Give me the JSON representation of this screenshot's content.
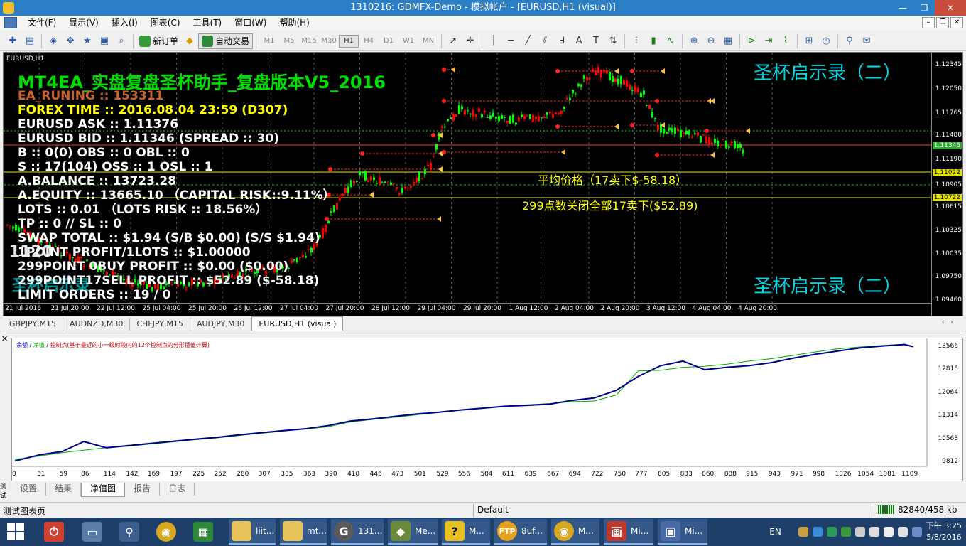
{
  "window": {
    "title": "1310216: GDMFX-Demo - 模拟帐户 - [EURUSD,H1 (visual)]",
    "minimize": "—",
    "restore": "❐",
    "close": "✕"
  },
  "menu": {
    "items": [
      "文件(F)",
      "显示(V)",
      "插入(I)",
      "图表(C)",
      "工具(T)",
      "窗口(W)",
      "帮助(H)"
    ],
    "mdi_buttons": [
      "–",
      "❐",
      "✕"
    ]
  },
  "toolbar": {
    "new_order": "新订单",
    "auto_trading": "自动交易",
    "timeframes": [
      "M1",
      "M5",
      "M15",
      "M30",
      "H1",
      "H4",
      "D1",
      "W1",
      "MN"
    ],
    "active_timeframe": "H1"
  },
  "chart": {
    "symbol_label": "EURUSD,H1",
    "ea_title": "MT4EA_实盘复盘圣杯助手_复盘版本V5_2016",
    "ea_running": "EA_RUNING :: 153311",
    "forex_time": "FOREX TIME :: 2016.08.04 23:59 (D307)",
    "info_lines": [
      "EURUSD ASK :: 1.11376",
      "EURUSD BID :: 1.11346  (SPREAD :: 30)",
      "B :: 0(0)  OBS :: 0  OBL :: 0",
      "S :: 17(104)  OSS :: 1  OSL :: 1",
      "A.BALANCE :: 13723.28",
      "A.EQUITY :: 13665.10 （CAPITAL RISK::9.11%）",
      "LOTS :: 0.01 （LOTS RISK :: 18.56%）",
      "TP :: 0 // SL :: 0",
      "SWAP TOTAL :: $1.94  (S/B $0.00)  (S/S $1.94)",
      "1POINT PROFIT/1LOTS :: $1.00000",
      "299POINT 0BUY PROFIT :: $0.00 ($0.00)",
      "299POINT17SELL PROFIT :: $52.89 ($-58.18)",
      "LIMIT ORDERS :: 19 / 0"
    ],
    "big_number": "1120",
    "ghost_text": "圣杯启示录",
    "watermark_top": "圣杯启示录（二）",
    "watermark_bottom": "圣杯启示录（二）",
    "avg_price": "平均价格（17卖下$-58.18）",
    "close_all": "299点数关闭全部17卖下($52.89)",
    "price_labels": [
      "1.12345",
      "1.12050",
      "1.11765",
      "1.11480",
      "1.11346",
      "1.11190",
      "1.11022",
      "1.10905",
      "1.10722",
      "1.10615",
      "1.10325",
      "1.10035",
      "1.09750",
      "1.09460"
    ],
    "highlight_bid": "1.11346",
    "highlight_level1": "1.11022",
    "highlight_level2": "1.10722",
    "time_labels": [
      "21 Jul 2016",
      "21 Jul 20:00",
      "22 Jul 12:00",
      "25 Jul 04:00",
      "25 Jul 20:00",
      "26 Jul 12:00",
      "27 Jul 04:00",
      "27 Jul 20:00",
      "28 Jul 12:00",
      "29 Jul 04:00",
      "29 Jul 20:00",
      "1 Aug 12:00",
      "2 Aug 04:00",
      "2 Aug 20:00",
      "3 Aug 12:00",
      "4 Aug 04:00",
      "4 Aug 20:00"
    ],
    "colors": {
      "bull": "#00ff00",
      "bear": "#ff0000",
      "grid": "#5a5a5a"
    }
  },
  "chart_tabs": {
    "items": [
      "GBPJPY,M15",
      "AUDNZD,M30",
      "CHFJPY,M15",
      "AUDJPY,M30",
      "EURUSD,H1 (visual)"
    ],
    "active": 4
  },
  "tester": {
    "vertical_label": "测试",
    "legend_balance": "余额",
    "legend_equity": "净值",
    "legend_control": "控制点(基于最近的小一级时段内的12个控制点的分形插值计算)",
    "tabs": [
      "设置",
      "结果",
      "净值图",
      "报告",
      "日志"
    ],
    "active_tab": 2
  },
  "chart_data": {
    "type": "line",
    "title": "",
    "x_ticks": [
      0,
      31,
      59,
      86,
      114,
      142,
      169,
      197,
      225,
      252,
      280,
      307,
      335,
      363,
      390,
      418,
      446,
      473,
      501,
      529,
      556,
      584,
      611,
      639,
      667,
      694,
      722,
      750,
      777,
      805,
      833,
      860,
      888,
      915,
      943,
      971,
      998,
      1026,
      1054,
      1081,
      1109
    ],
    "y_ticks": [
      13566,
      12815,
      12064,
      11314,
      10563,
      9812
    ],
    "ylim": [
      9812,
      13700
    ],
    "xlim": [
      0,
      1130
    ],
    "series": [
      {
        "name": "余额",
        "color": "#00aa00",
        "x": [
          0,
          31,
          59,
          86,
          114,
          142,
          169,
          197,
          225,
          252,
          280,
          307,
          335,
          363,
          390,
          418,
          446,
          473,
          501,
          529,
          556,
          584,
          611,
          639,
          667,
          694,
          722,
          750,
          777,
          805,
          833,
          860,
          888,
          915,
          943,
          971,
          998,
          1026,
          1054,
          1081,
          1109,
          1120
        ],
        "y": [
          9900,
          10010,
          10120,
          10200,
          10280,
          10330,
          10400,
          10470,
          10540,
          10600,
          10680,
          10750,
          10820,
          10890,
          10960,
          11120,
          11200,
          11270,
          11350,
          11430,
          11500,
          11560,
          11620,
          11680,
          11720,
          11780,
          11800,
          12000,
          12780,
          12800,
          12900,
          12930,
          13000,
          13100,
          13180,
          13290,
          13400,
          13500,
          13560,
          13610,
          13650,
          13580
        ]
      },
      {
        "name": "净值",
        "color": "#00008b",
        "x": [
          0,
          31,
          59,
          86,
          114,
          142,
          169,
          197,
          225,
          252,
          280,
          307,
          335,
          363,
          390,
          418,
          446,
          473,
          501,
          529,
          556,
          584,
          611,
          639,
          667,
          694,
          722,
          750,
          777,
          805,
          833,
          860,
          888,
          915,
          943,
          971,
          998,
          1026,
          1054,
          1081,
          1109,
          1120
        ],
        "y": [
          9850,
          10050,
          10160,
          10480,
          10280,
          10350,
          10420,
          10490,
          10560,
          10620,
          10700,
          10770,
          10840,
          10900,
          11000,
          11150,
          11220,
          11300,
          11380,
          11440,
          11510,
          11570,
          11630,
          11660,
          11700,
          11820,
          11900,
          12150,
          12600,
          12950,
          13100,
          12820,
          12900,
          12950,
          13050,
          13200,
          13320,
          13430,
          13530,
          13590,
          13640,
          13570
        ]
      }
    ]
  },
  "statusbar": {
    "left": "测试图表页",
    "middle": "Default",
    "right": "82840/458 kb"
  },
  "taskbar": {
    "tasks": [
      "",
      "",
      "",
      "",
      "",
      "liit...",
      "mt...",
      "131...",
      "Me...",
      "M...",
      "8uf...",
      "M...",
      "Mi...",
      "Mi..."
    ],
    "lang": "EN",
    "time": "下午 3:25",
    "date": "5/8/2016"
  }
}
